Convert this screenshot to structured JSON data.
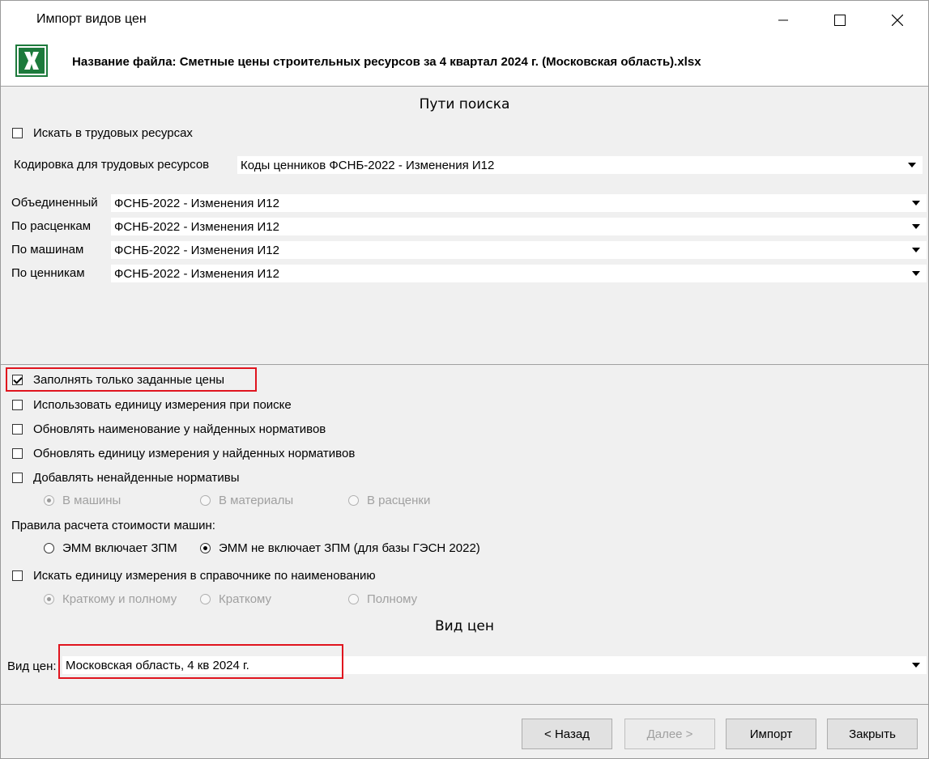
{
  "window": {
    "title": "Импорт видов цен",
    "file_title": "Название файла: Сметные цены строительных ресурсов за 4 квартал 2024 г. (Московская область).xlsx",
    "icons": {
      "app": "excel-icon",
      "minimize": "minimize-icon",
      "maximize": "maximize-icon",
      "close": "close-icon"
    }
  },
  "search_paths": {
    "title": "Пути поиска",
    "labor_search_label": "Искать в трудовых ресурсах",
    "labor_search_checked": false,
    "labor_encoding_label": "Кодировка для трудовых ресурсов",
    "labor_encoding_value": "Коды ценников ФСНБ-2022 - Изменения И12",
    "rows": [
      {
        "label": "Объединенный",
        "value": "ФСНБ-2022 - Изменения И12"
      },
      {
        "label": "По расценкам",
        "value": "ФСНБ-2022 - Изменения И12"
      },
      {
        "label": "По машинам",
        "value": "ФСНБ-2022 - Изменения И12"
      },
      {
        "label": "По ценникам",
        "value": "ФСНБ-2022 - Изменения И12"
      }
    ]
  },
  "options": {
    "fill_only": {
      "label": "Заполнять только заданные цены",
      "checked": true
    },
    "use_unit": {
      "label": "Использовать единицу измерения при поиске",
      "checked": false
    },
    "update_name": {
      "label": "Обновлять наименование у найденных нормативов",
      "checked": false
    },
    "update_unit": {
      "label": "Обновлять единицу измерения у найденных нормативов",
      "checked": false
    },
    "add_missing": {
      "label": "Добавлять ненайденные нормативы",
      "checked": false
    },
    "add_targets": [
      "В машины",
      "В материалы",
      "В расценки"
    ],
    "add_target_selected": "В машины",
    "machine_rules_label": "Правила расчета стоимости машин:",
    "machine_rules": [
      "ЭММ включает ЗПМ",
      "ЭММ не включает ЗПМ (для базы ГЭСН 2022)"
    ],
    "machine_rule_selected": "ЭММ не включает ЗПМ (для базы ГЭСН 2022)",
    "unit_lookup": {
      "label": "Искать единицу измерения в справочнике по наименованию",
      "checked": false
    },
    "unit_lookup_modes": [
      "Краткому и полному",
      "Краткому",
      "Полному"
    ],
    "unit_lookup_selected": "Краткому и полному"
  },
  "price_type": {
    "title": "Вид цен",
    "label": "Вид цен:",
    "value": "Московская область, 4 кв 2024 г."
  },
  "buttons": {
    "back": "< Назад",
    "next": "Далее >",
    "import": "Импорт",
    "close": "Закрыть"
  },
  "colors": {
    "highlight": "#e0141e",
    "excel_green": "#1d7a3c"
  }
}
